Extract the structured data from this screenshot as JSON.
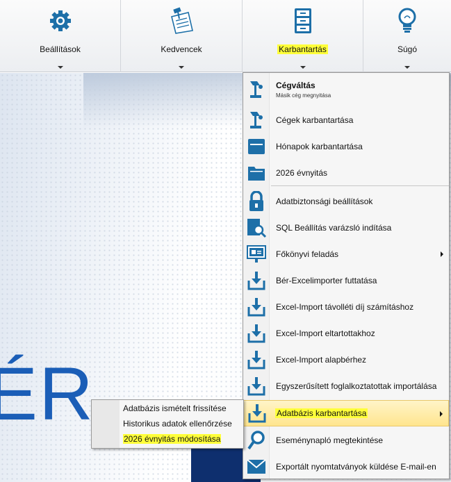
{
  "toolbar": {
    "buttons": [
      {
        "label": "Beállítások",
        "icon": "gear-icon",
        "highlighted": false
      },
      {
        "label": "Kedvencek",
        "icon": "pinned-note-icon",
        "highlighted": false
      },
      {
        "label": "Karbantartás",
        "icon": "file-cabinet-icon",
        "highlighted": true
      },
      {
        "label": "Súgó",
        "icon": "lightbulb-icon",
        "highlighted": false
      }
    ]
  },
  "background": {
    "brand_text": "ÉR"
  },
  "menu": {
    "items": [
      {
        "label": "Cégváltás",
        "subtitle": "Másik cég megnyitása",
        "icon": "desk-lamp-icon"
      },
      {
        "label": "Cégek karbantartása",
        "icon": "desk-lamp-icon"
      },
      {
        "label": "Hónapok karbantartása",
        "icon": "archive-box-icon"
      },
      {
        "label": "2026 évnyitás",
        "icon": "folder-icon"
      },
      {
        "label": "Adatbiztonsági beállítások",
        "icon": "padlock-icon"
      },
      {
        "label": "SQL Beállítás varázsló indítása",
        "icon": "search-document-icon"
      },
      {
        "label": "Főkönyvi feladás",
        "icon": "presentation-board-icon",
        "has_submenu": true
      },
      {
        "label": "Bér-Excelimporter futtatása",
        "icon": "import-tray-icon"
      },
      {
        "label": "Excel-Import távolléti díj számításhoz",
        "icon": "import-tray-icon"
      },
      {
        "label": "Excel-Import eltartottakhoz",
        "icon": "import-tray-icon"
      },
      {
        "label": "Excel-Import alapbérhez",
        "icon": "import-tray-icon"
      },
      {
        "label": "Egyszerűsített foglalkoztatottak importálása",
        "icon": "import-tray-icon"
      },
      {
        "label": "Adatbázis karbantartása",
        "icon": "import-tray-icon",
        "has_submenu": true,
        "active": true
      },
      {
        "label": "Eseménynapló megtekintése",
        "icon": "magnifier-icon"
      },
      {
        "label": "Exportált nyomtatványok küldése E-mail-en",
        "icon": "envelope-icon"
      }
    ]
  },
  "submenu": {
    "items": [
      {
        "label": "Adatbázis ismételt frissítése"
      },
      {
        "label": "Historikus adatok ellenőrzése"
      },
      {
        "label": "2026 évnyitás módosítása",
        "highlighted": true
      }
    ]
  },
  "colors": {
    "icon_blue": "#1d6fa8",
    "highlight_yellow": "#ffff3a",
    "brand_blue": "#1b5eb7"
  }
}
